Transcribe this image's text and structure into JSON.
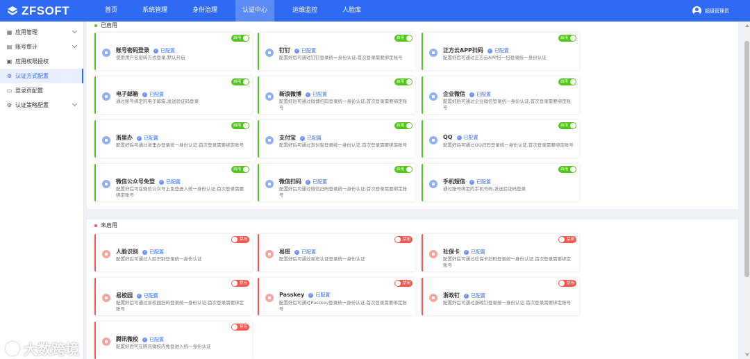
{
  "header": {
    "logo_text": "ZFSOFT",
    "nav": [
      {
        "label": "首页",
        "active": false
      },
      {
        "label": "系统管理",
        "active": false
      },
      {
        "label": "身份治理",
        "active": false
      },
      {
        "label": "认证中心",
        "active": true
      },
      {
        "label": "运维监控",
        "active": false
      },
      {
        "label": "人脸库",
        "active": false
      }
    ],
    "user_name": "超级管理员"
  },
  "sidebar": {
    "items": [
      {
        "label": "应用管理",
        "icon": "app-grid-icon",
        "expandable": true,
        "active": false
      },
      {
        "label": "账号审计",
        "icon": "audit-icon",
        "expandable": true,
        "active": false
      },
      {
        "label": "应用权限授权",
        "icon": "permission-icon",
        "expandable": false,
        "active": false
      },
      {
        "label": "认证方式配置",
        "icon": "gear-icon",
        "expandable": false,
        "active": true
      },
      {
        "label": "登录页配置",
        "icon": "login-page-icon",
        "expandable": false,
        "active": false
      },
      {
        "label": "认证策略配置",
        "icon": "policy-icon",
        "expandable": true,
        "active": false
      }
    ]
  },
  "enabled_section": {
    "title": "已启用",
    "status_label": "已配置",
    "toggle_label": "启用",
    "color": "#52c41a",
    "cards": [
      {
        "name": "账号密码登录",
        "desc": "使用用户名密码方式登录,默认开启"
      },
      {
        "name": "钉钉",
        "desc": "配置好后可通过钉钉登录统一身份认证,首次登录需要绑定账号"
      },
      {
        "name": "正方云APP扫码",
        "desc": "配置好后可通过正方云APP扫一扫登录统一身份认证"
      },
      {
        "name": "电子邮箱",
        "desc": "通过账号绑定的电子邮箱,发送验证码登录"
      },
      {
        "name": "新浪微博",
        "desc": "配置好后可通过微博扫码登录统一身份认证,首次登录需要绑定账号"
      },
      {
        "name": "企业微信",
        "desc": "配置好后可通过企业微信登录统一身份认证,首次登录需要绑定账号"
      },
      {
        "name": "浙里办",
        "desc": "配置好后可通过浙里办登录统一身份认证,首次登录需要绑定账号"
      },
      {
        "name": "支付宝",
        "desc": "配置好后可通过支付宝登录统一身份认证,首次登录需要绑定账号"
      },
      {
        "name": "QQ",
        "desc": "配置好后可通过QQ扫码登录统一身份认证,首次登录需要绑定账号"
      },
      {
        "name": "微信公众号免登",
        "desc": "配置好后可在微信公众号上免登进入统一身份认证,首次登录需要绑定账号"
      },
      {
        "name": "微信扫码",
        "desc": "配置好后可通过微信扫码登录统一身份认证,首次登录需要绑定账号"
      },
      {
        "name": "手机短信",
        "desc": "通过账号绑定的手机号码,发送验证码登录"
      }
    ]
  },
  "disabled_section": {
    "title": "未启用",
    "status_label": "已配置",
    "toggle_label": "禁用",
    "color": "#f5574d",
    "cards": [
      {
        "name": "人脸识别",
        "desc": "配置好后可通过人脸识别登录统一身份认证"
      },
      {
        "name": "易班",
        "desc": "配置好后可通过易班认证登录统一身份认证"
      },
      {
        "name": "社保卡",
        "desc": "配置好后可通过社保卡扫码登录统一身份认证,首次登录需要绑定账号"
      },
      {
        "name": "易校园",
        "desc": "配置好后可通过易校园扫码登录统一身份认证,首次登录需要绑定账号"
      },
      {
        "name": "Passkey",
        "desc": "配置好后可通过Passkey登录统一身份认证,首次登录需要绑定账号"
      },
      {
        "name": "浙政钉",
        "desc": "配置好后可通过浙政钉登录统一身份认证,首次登录需要绑定账号"
      },
      {
        "name": "腾讯微校",
        "desc": "配置好后可在腾讯微校内免登进入统一身份认证"
      }
    ]
  },
  "watermark": "大数跨境"
}
